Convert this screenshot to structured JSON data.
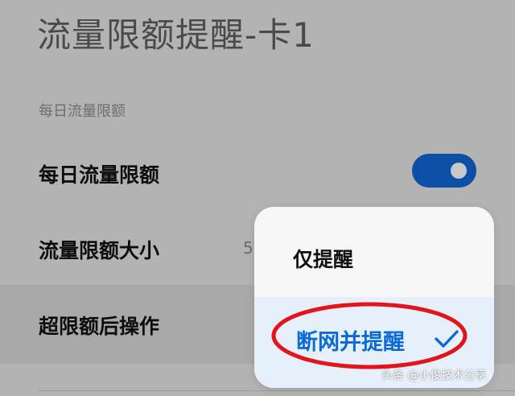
{
  "page": {
    "title": "流量限额提醒-卡1"
  },
  "section": {
    "label": "每日流量限额"
  },
  "rows": {
    "daily_limit": {
      "label": "每日流量限额",
      "toggle_on": true
    },
    "limit_size": {
      "label": "流量限额大小",
      "value": "5"
    },
    "over_limit_action": {
      "label": "超限额后操作"
    }
  },
  "popup": {
    "options": [
      {
        "label": "仅提醒",
        "selected": false
      },
      {
        "label": "断网并提醒",
        "selected": true
      }
    ]
  },
  "watermark": {
    "text": "头条 @小俊技术分享"
  },
  "colors": {
    "accent": "#0c6ad8",
    "toggle": "#0d4fa6",
    "annotation": "#e4141b",
    "dim_background": "#b3b3b3"
  },
  "icons": {
    "selected": "check-icon"
  }
}
